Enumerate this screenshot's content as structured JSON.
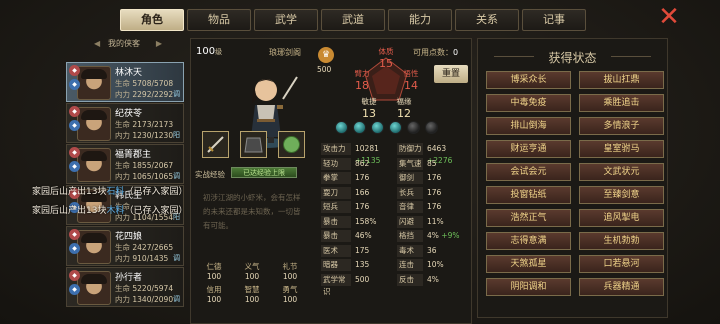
{
  "tabs": [
    "角色",
    "物品",
    "武学",
    "武道",
    "能力",
    "关系",
    "记事"
  ],
  "active_tab": 0,
  "close_glyph": "✕",
  "roster": {
    "title": "我的侠客",
    "members": [
      {
        "name": "林沐天",
        "hp_label": "生命",
        "hp": "5708/5708",
        "mp_label": "内力",
        "mp": "2292/2292",
        "tag": "调",
        "selected": true
      },
      {
        "name": "纪茯苓",
        "hp_label": "生命",
        "hp": "2173/2173",
        "mp_label": "内力",
        "mp": "1230/1230",
        "tag": "阳",
        "selected": false
      },
      {
        "name": "福箐郡主",
        "hp_label": "生命",
        "hp": "1855/2067",
        "mp_label": "内力",
        "mp": "1065/1065",
        "tag": "调",
        "selected": false
      },
      {
        "name": "韩氏生",
        "hp_label": "生命",
        "hp": "",
        "mp_label": "内力",
        "mp": "1104/1554",
        "tag": "阳",
        "selected": false
      },
      {
        "name": "花四娘",
        "hp_label": "生命",
        "hp": "2427/2665",
        "mp_label": "内力",
        "mp": "910/1435",
        "tag": "调",
        "selected": false
      },
      {
        "name": "孙行者",
        "hp_label": "生命",
        "hp": "5220/5974",
        "mp_label": "内力",
        "mp": "1340/2090",
        "tag": "调",
        "selected": false
      }
    ]
  },
  "profile": {
    "level": "100",
    "level_unit": "级",
    "faction": "琅琊剑阁",
    "coin": "500",
    "points_label": "可用点数：",
    "points_value": "0",
    "reset_label": "重置",
    "attributes": [
      {
        "label": "体质",
        "value": "15",
        "red": true
      },
      {
        "label": "臂力",
        "value": "18",
        "red": true
      },
      {
        "label": "悟性",
        "value": "14",
        "red": true
      },
      {
        "label": "敏捷",
        "value": "13",
        "red": false
      },
      {
        "label": "福缘",
        "value": "12",
        "red": false
      }
    ],
    "gems": [
      true,
      true,
      true,
      true,
      false,
      false
    ],
    "exp_label": "实战经验",
    "exp_text": "已达经验上限",
    "exp_fraction": 1.0,
    "bio": "初涉江湖的小虾米，会有怎样的未来还都是未知数，一切皆有可能。",
    "virtues": [
      {
        "label": "仁德",
        "value": "100"
      },
      {
        "label": "义气",
        "value": "100"
      },
      {
        "label": "礼节",
        "value": "100"
      },
      {
        "label": "信用",
        "value": "100"
      },
      {
        "label": "智慧",
        "value": "100"
      },
      {
        "label": "勇气",
        "value": "100"
      }
    ]
  },
  "combat_stats": {
    "left": [
      {
        "label": "攻击力",
        "value": "10281",
        "bonus": "+1135"
      },
      {
        "label": "轻功",
        "value": "862",
        "bonus": ""
      },
      {
        "label": "拳掌",
        "value": "176",
        "bonus": ""
      },
      {
        "label": "耍刀",
        "value": "166",
        "bonus": ""
      },
      {
        "label": "短兵",
        "value": "176",
        "bonus": ""
      },
      {
        "label": "暴击",
        "value": "158%",
        "bonus": ""
      },
      {
        "label": "暴击",
        "value": "46%",
        "bonus": ""
      },
      {
        "label": "医术",
        "value": "175",
        "bonus": ""
      },
      {
        "label": "暗器",
        "value": "135",
        "bonus": ""
      },
      {
        "label": "武学常识",
        "value": "500",
        "bonus": ""
      }
    ],
    "right": [
      {
        "label": "防御力",
        "value": "6463",
        "bonus": "+2276"
      },
      {
        "label": "集气速度",
        "value": "85",
        "bonus": ""
      },
      {
        "label": "御剑",
        "value": "176",
        "bonus": ""
      },
      {
        "label": "长兵",
        "value": "176",
        "bonus": ""
      },
      {
        "label": "音律",
        "value": "176",
        "bonus": ""
      },
      {
        "label": "闪避",
        "value": "11%",
        "bonus": ""
      },
      {
        "label": "格挡",
        "value": "4%",
        "bonus": "+9%"
      },
      {
        "label": "毒术",
        "value": "36",
        "bonus": ""
      },
      {
        "label": "连击",
        "value": "10%",
        "bonus": ""
      },
      {
        "label": "反击",
        "value": "4%",
        "bonus": ""
      }
    ]
  },
  "status": {
    "title": "获得状态",
    "items": [
      "博采众长",
      "拔山扛鼎",
      "中毒免疫",
      "乘胜追击",
      "排山倒海",
      "多情浪子",
      "财运亨通",
      "皇室驸马",
      "会试会元",
      "文武状元",
      "投窗钻纸",
      "至臻剑意",
      "浩然正气",
      "追风掣电",
      "志得意满",
      "生机勃勃",
      "天煞孤星",
      "口若悬河",
      "阴阳调和",
      "兵器精通"
    ]
  },
  "log": [
    {
      "prefix": "家园后山产出13块",
      "item": "石料",
      "suffix": "（已存入家园）"
    },
    {
      "prefix": "家园后山产出13块",
      "item": "木料",
      "suffix": "（已存入家园）"
    }
  ],
  "colors": {
    "accent": "#e25c4b",
    "state_text": "#f0d48a",
    "bonus": "#6ec05a"
  }
}
